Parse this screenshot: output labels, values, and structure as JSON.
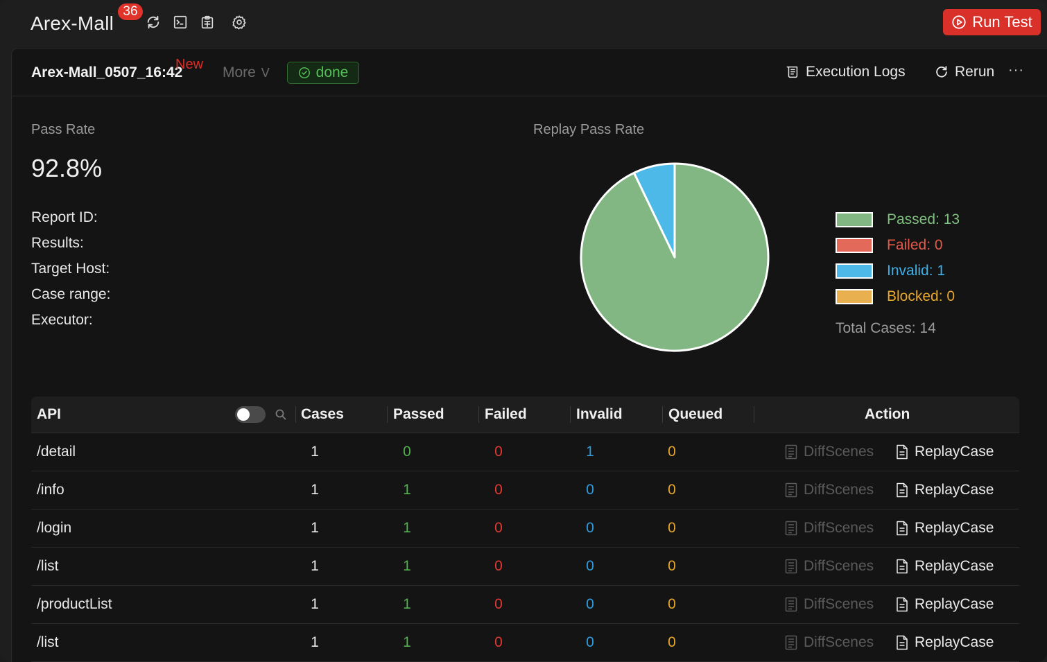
{
  "header": {
    "app_title": "Arex-Mall",
    "badge_count": "36",
    "run_test_label": "Run Test",
    "icons": [
      "refresh-icon",
      "terminal-icon",
      "clipboard-icon",
      "settings-icon"
    ]
  },
  "report": {
    "name": "Arex-Mall_0507_16:42",
    "new_tag": "New",
    "more_label": "More",
    "status": "done",
    "execution_logs_label": "Execution Logs",
    "rerun_label": "Rerun",
    "more_dots": "···"
  },
  "stats": {
    "pass_rate_label": "Pass Rate",
    "pass_rate_value": "92.8%",
    "info": [
      "Report ID:",
      "Results:",
      "Target Host:",
      "Case range:",
      "Executor:"
    ]
  },
  "chart_data": {
    "type": "pie",
    "title": "Replay Pass Rate",
    "categories": [
      "Passed",
      "Failed",
      "Invalid",
      "Blocked"
    ],
    "values": [
      13,
      0,
      1,
      0
    ],
    "legend": [
      "Passed: 13",
      "Failed: 0",
      "Invalid: 1",
      "Blocked: 0"
    ],
    "colors": [
      "#82b783",
      "#e36a5b",
      "#4cb9e8",
      "#e8b04f"
    ],
    "legend_text_colors": [
      "#7fc17f",
      "#e45a4a",
      "#3fb0e8",
      "#e8a62a"
    ],
    "legend_position": "right",
    "total_label": "Total Cases: 14"
  },
  "table": {
    "columns": [
      "API",
      "Cases",
      "Passed",
      "Failed",
      "Invalid",
      "Queued",
      "Action"
    ],
    "diff_label": "DiffScenes",
    "replay_label": "ReplayCase",
    "rows": [
      {
        "api": "/detail",
        "cases": "1",
        "passed": "0",
        "failed": "0",
        "invalid": "1",
        "queued": "0"
      },
      {
        "api": "/info",
        "cases": "1",
        "passed": "1",
        "failed": "0",
        "invalid": "0",
        "queued": "0"
      },
      {
        "api": "/login",
        "cases": "1",
        "passed": "1",
        "failed": "0",
        "invalid": "0",
        "queued": "0"
      },
      {
        "api": "/list",
        "cases": "1",
        "passed": "1",
        "failed": "0",
        "invalid": "0",
        "queued": "0"
      },
      {
        "api": "/productList",
        "cases": "1",
        "passed": "1",
        "failed": "0",
        "invalid": "0",
        "queued": "0"
      },
      {
        "api": "/list",
        "cases": "1",
        "passed": "1",
        "failed": "0",
        "invalid": "0",
        "queued": "0"
      }
    ]
  }
}
